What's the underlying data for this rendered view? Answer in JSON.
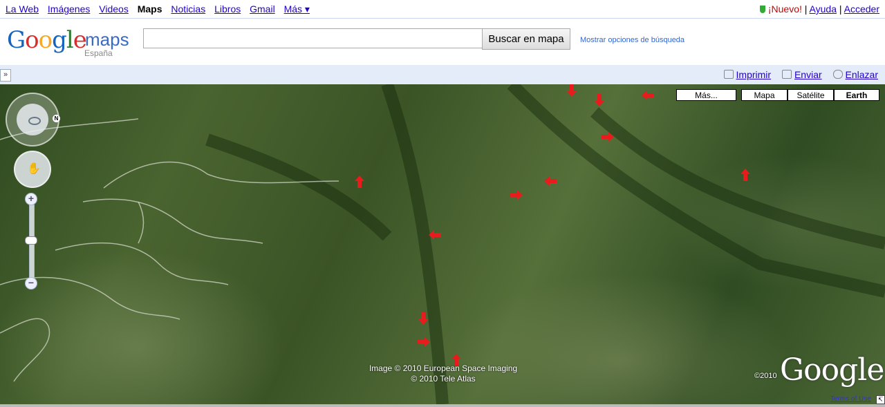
{
  "topnav": {
    "items": [
      {
        "label": "La Web",
        "active": false
      },
      {
        "label": "Imágenes",
        "active": false
      },
      {
        "label": "Videos",
        "active": false
      },
      {
        "label": "Maps",
        "active": true
      },
      {
        "label": "Noticias",
        "active": false
      },
      {
        "label": "Libros",
        "active": false
      },
      {
        "label": "Gmail",
        "active": false
      },
      {
        "label": "Más ▾",
        "active": false
      }
    ],
    "new_label": "¡Nuevo!",
    "help_label": "Ayuda",
    "signin_label": "Acceder",
    "separator": "|"
  },
  "header": {
    "logo_word": "Google",
    "logo_letters": [
      "G",
      "o",
      "o",
      "g",
      "l",
      "e"
    ],
    "logo_maps": "maps",
    "logo_region": "España",
    "search_value": "",
    "search_button": "Buscar en mapa",
    "search_options": "Mostrar opciones de búsqueda"
  },
  "toolbar": {
    "collapse_glyph": "»",
    "print_label": "Imprimir",
    "send_label": "Enviar",
    "link_label": "Enlazar"
  },
  "map": {
    "view": "Earth",
    "type_buttons": {
      "more": "Más...",
      "map": "Mapa",
      "satellite": "Satélite",
      "earth": "Earth"
    },
    "nav_badge": "N",
    "zoom_in": "+",
    "zoom_out": "−",
    "credit_line1": "Image © 2010 European Space Imaging",
    "credit_line2": "© 2010 Tele Atlas",
    "copyright_year": "©2010",
    "watermark": "Google",
    "terms_label": "Terms of Use",
    "expand_glyph": "↸",
    "marker_color": "#e81c1c",
    "markers": [
      {
        "dir": "down"
      },
      {
        "dir": "down"
      },
      {
        "dir": "left"
      },
      {
        "dir": "right"
      },
      {
        "dir": "up"
      },
      {
        "dir": "left"
      },
      {
        "dir": "right"
      },
      {
        "dir": "up"
      },
      {
        "dir": "left"
      },
      {
        "dir": "down"
      },
      {
        "dir": "right"
      },
      {
        "dir": "up"
      }
    ]
  }
}
